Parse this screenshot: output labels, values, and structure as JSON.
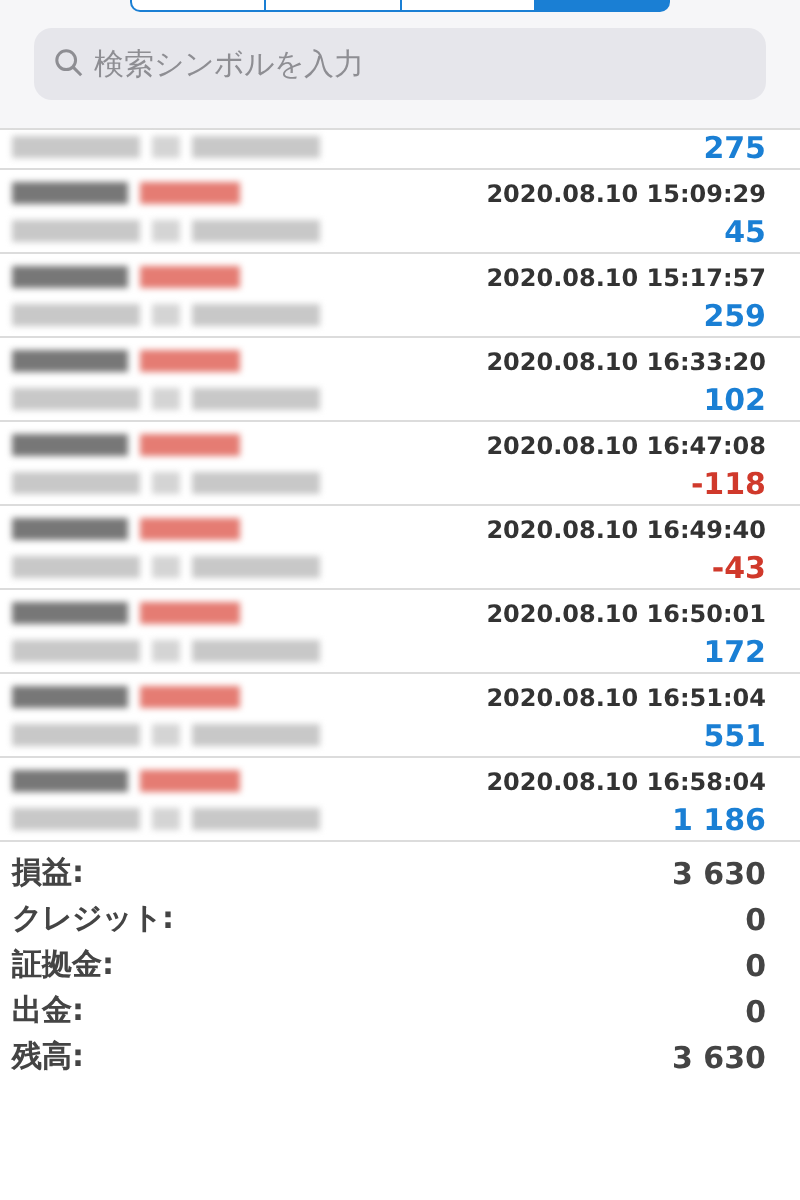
{
  "segments": [
    {
      "selected": false
    },
    {
      "selected": false
    },
    {
      "selected": false
    },
    {
      "selected": true
    }
  ],
  "search": {
    "placeholder": "検索シンボルを入力"
  },
  "deals": [
    {
      "profit": "275",
      "color": "#1a7fd4"
    },
    {
      "time": "2020.08.10 15:09:29",
      "profit": "45",
      "color": "#1a7fd4"
    },
    {
      "time": "2020.08.10 15:17:57",
      "profit": "259",
      "color": "#1a7fd4"
    },
    {
      "time": "2020.08.10 16:33:20",
      "profit": "102",
      "color": "#1a7fd4"
    },
    {
      "time": "2020.08.10 16:47:08",
      "profit": "-118",
      "color": "#d0392b"
    },
    {
      "time": "2020.08.10 16:49:40",
      "profit": "-43",
      "color": "#d0392b"
    },
    {
      "time": "2020.08.10 16:50:01",
      "profit": "172",
      "color": "#1a7fd4"
    },
    {
      "time": "2020.08.10 16:51:04",
      "profit": "551",
      "color": "#1a7fd4"
    },
    {
      "time": "2020.08.10 16:58:04",
      "profit": "1 186",
      "color": "#1a7fd4"
    }
  ],
  "summary": [
    {
      "label": "損益:",
      "value": "3 630"
    },
    {
      "label": "クレジット:",
      "value": "0"
    },
    {
      "label": "証拠金:",
      "value": "0"
    },
    {
      "label": "出金:",
      "value": "0"
    },
    {
      "label": "残高:",
      "value": "3 630"
    }
  ]
}
